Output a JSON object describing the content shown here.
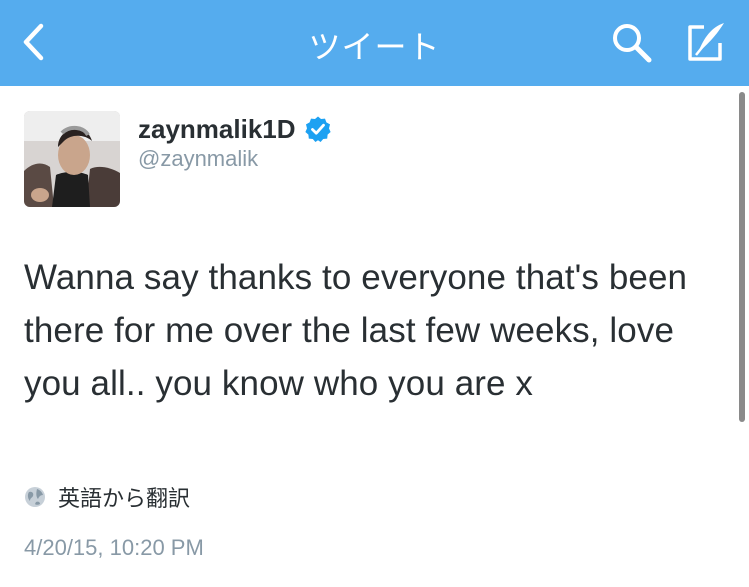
{
  "navbar": {
    "title": "ツイート",
    "background_color": "#55acee",
    "back_icon": "chevron-left-icon",
    "search_icon": "search-icon",
    "compose_icon": "compose-tweet-icon"
  },
  "tweet": {
    "display_name": "zaynmalik1D",
    "verified": true,
    "handle": "@zaynmalik",
    "text": "Wanna say thanks to everyone that's been there for me over the last few weeks,  love you all.. you know who you are x",
    "translate_label": "英語から翻訳",
    "translate_icon": "globe-icon",
    "timestamp": "4/20/15, 10:20 PM"
  },
  "colors": {
    "accent": "#55acee",
    "verified": "#1da1f2",
    "text_primary": "#292f33",
    "text_secondary": "#8899a6"
  }
}
